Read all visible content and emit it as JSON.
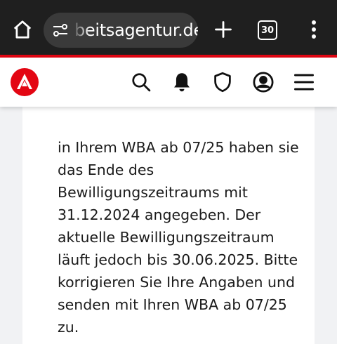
{
  "browser": {
    "url_fragment": "beitsagentur.de",
    "tab_count": "30",
    "icons": [
      "home-icon",
      "site-settings-icon",
      "plus-icon",
      "tabs-icon",
      "more-vert-icon"
    ]
  },
  "site_header": {
    "logo": "agentur-logo",
    "icons": [
      "search-icon",
      "bell-icon",
      "shield-icon",
      "account-icon",
      "hamburger-icon"
    ]
  },
  "message": {
    "text": "in Ihrem WBA ab 07/25 haben sie das Ende des Bewilligungszeitraums mit 31.12.2024 angegeben. Der aktuelle Bewilligungszeitraum läuft jedoch bis 30.06.2025. Bitte korrigieren Sie Ihre Angaben und senden mit Ihren WBA ab 07/25 zu."
  },
  "colors": {
    "browser_bg": "#1f1f1f",
    "accent_red": "#e30613",
    "page_bg": "#f1f2f4"
  }
}
